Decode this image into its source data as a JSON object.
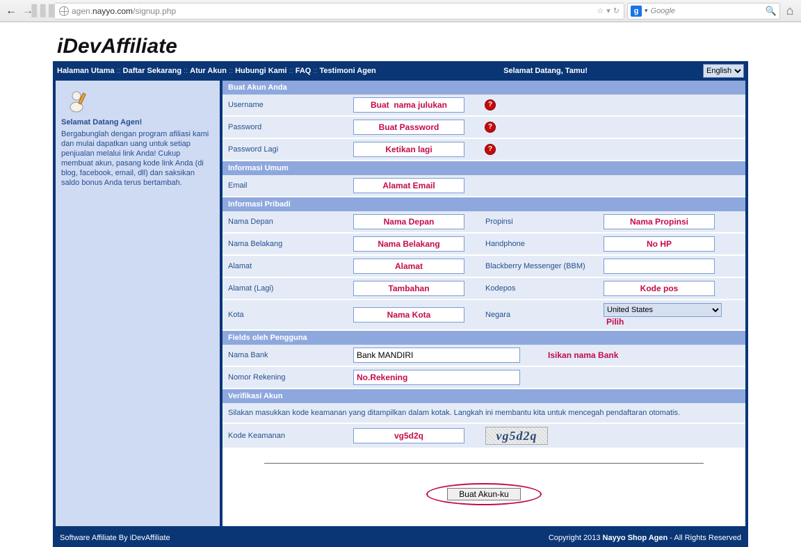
{
  "browser": {
    "url_prefix": "agen.",
    "url_domain": "nayyo.com",
    "url_path": "/signup.php",
    "search_provider": "g",
    "search_placeholder": "Google"
  },
  "logo": "iDevAffiliate",
  "nav": {
    "halaman_utama": "Halaman Utama",
    "daftar_sekarang": "Daftar Sekarang",
    "atur_akun": "Atur Akun",
    "hubungi_kami": "Hubungi Kami",
    "faq": "FAQ",
    "testimoni_agen": "Testimoni Agen"
  },
  "welcome_msg": "Selamat Datang, Tamu!",
  "lang_selected": "English",
  "sidebar": {
    "heading": "Selamat Datang Agen!",
    "body": "Bergabunglah dengan program afiliasi kami dan mulai dapatkan uang untuk setiap penjualan melalui link Anda! Cukup membuat akun, pasang kode link Anda (di blog, facebook, email, dll) dan saksikan saldo bonus Anda terus bertambah."
  },
  "sections": {
    "buat_akun": "Buat Akun Anda",
    "info_umum": "Informasi Umum",
    "info_pribadi": "Informasi Pribadi",
    "fields_pengguna": "Fields oleh Pengguna",
    "verifikasi": "Verifikasi Akun"
  },
  "labels": {
    "username": "Username",
    "password": "Password",
    "password_lagi": "Password Lagi",
    "email": "Email",
    "nama_depan": "Nama Depan",
    "nama_belakang": "Nama Belakang",
    "alamat": "Alamat",
    "alamat_lagi": "Alamat (Lagi)",
    "kota": "Kota",
    "propinsi": "Propinsi",
    "handphone": "Handphone",
    "bbm": "Blackberry Messenger (BBM)",
    "kodepos": "Kodepos",
    "negara": "Negara",
    "nama_bank": "Nama Bank",
    "nomor_rekening": "Nomor Rekening",
    "kode_keamanan": "Kode Keamanan"
  },
  "values": {
    "username": "Buat  nama julukan",
    "password": "Buat Password",
    "password_lagi": "Ketikan lagi",
    "email": "Alamat Email",
    "nama_depan": "Nama Depan",
    "nama_belakang": "Nama Belakang",
    "alamat": "Alamat",
    "alamat_lagi": "Tambahan",
    "kota": "Nama Kota",
    "propinsi": "Nama Propinsi",
    "handphone": "No HP",
    "bbm": "",
    "kodepos": "Kode pos",
    "negara": "United States",
    "nama_bank": "Bank MANDIRI",
    "nomor_rekening": "No.Rekening",
    "kode_keamanan": "vg5d2q"
  },
  "hints": {
    "nama_bank": "Isikan nama Bank",
    "pilih": "Pilih"
  },
  "verify_instructions": "Silakan masukkan kode keamanan yang ditampilkan dalam kotak. Langkah ini membantu kita untuk mencegah pendaftaran otomatis.",
  "captcha_text": "vg5d2q",
  "submit_label": "Buat Akun-ku",
  "footer": {
    "left_prefix": "Software Affiliate By ",
    "left_brand": "iDevAffiliate",
    "right_prefix": "Copyright 2013 ",
    "right_brand": "Nayyo Shop Agen",
    "right_suffix": " - All Rights Reserved"
  }
}
